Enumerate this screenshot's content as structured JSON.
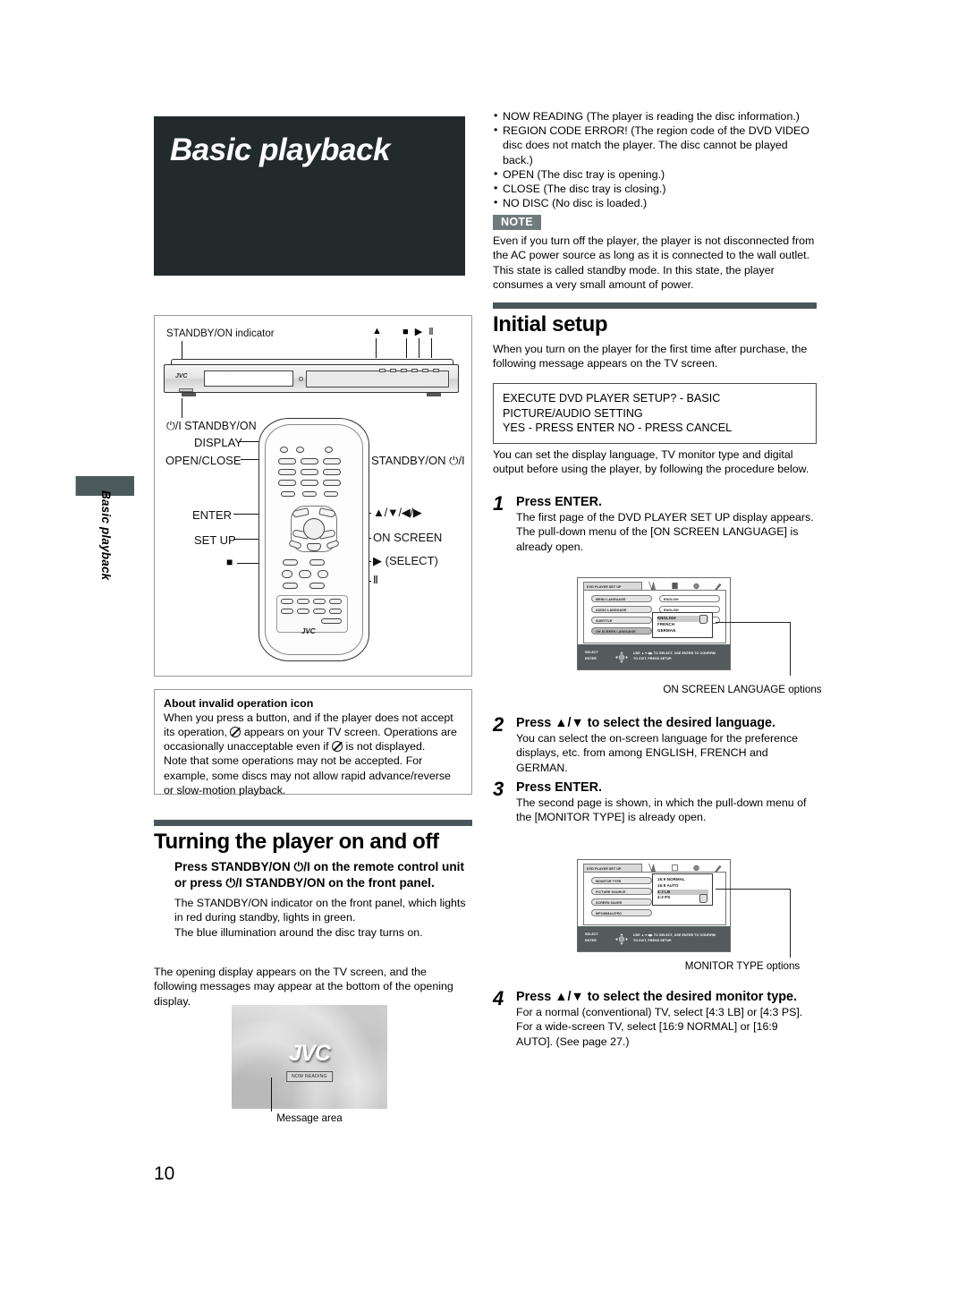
{
  "page": {
    "number": "10",
    "side_tab_label": "Basic playback",
    "title": "Basic playback"
  },
  "left": {
    "hw_figure": {
      "labels": {
        "standby_indicator": "STANDBY/ON indicator",
        "standby_front": "⏻/I STANDBY/ON",
        "display": "DISPLAY",
        "open_close": "OPEN/CLOSE",
        "enter": "ENTER",
        "set_up": "SET UP",
        "standby_remote": "STANDBY/ON ⏻/I",
        "arrows": "▲/▼/◀/▶",
        "on_screen": "ON SCREEN",
        "select": "▶ (SELECT)",
        "stop_icon": "■",
        "pause_icon": "Ⅱ",
        "eject_icon": "▲",
        "panel_icons": "■ ▶ Ⅱ",
        "remote_brand": "JVC",
        "panel_brand": "JVC"
      }
    },
    "invalid_box": {
      "heading": "About invalid operation icon",
      "body_1": "When you press a button, and if the player does not accept its operation,",
      "body_2": "appears on your TV screen. Operations are occasionally unacceptable even if",
      "body_3": "is not displayed.",
      "body_4": "Note that some operations may not be accepted. For example, some discs may not allow rapid advance/reverse or slow-motion playback."
    },
    "turning_section": {
      "heading": "Turning the player on and off",
      "bold_1": "Press STANDBY/ON",
      "bold_icon": "⏻/I",
      "bold_2": "on the remote control unit or press",
      "bold_3": "STANDBY/ON on the front panel.",
      "para_1": "The STANDBY/ON indicator on the front panel, which lights in red during standby, lights in green.",
      "para_2": "The blue illumination around the disc tray turns on.",
      "para_3": "The opening display appears on the TV screen, and the following messages may appear at the bottom of the opening display."
    },
    "opening_display": {
      "logo": "JVC",
      "message": "NOW READING",
      "caption": "Message area"
    }
  },
  "right": {
    "messages": [
      "NOW READING (The player is reading the disc information.)",
      "REGION CODE ERROR! (The region code of the DVD VIDEO disc does not match the player. The disc cannot be played back.)",
      "OPEN (The disc tray is opening.)",
      "CLOSE (The disc tray is closing.)",
      "NO DISC (No disc is loaded.)"
    ],
    "note": {
      "badge": "NOTE",
      "text": "Even if you turn off the player, the player is not disconnected from the AC power source as long as it is connected to the wall outlet. This state is called standby mode. In this state, the player consumes a very small amount of power."
    },
    "initial_setup": {
      "heading": "Initial setup",
      "intro": "When you turn on the player for the first time after purchase, the following message appears on the TV screen.",
      "message_box_line1": "EXECUTE DVD PLAYER SETUP? - BASIC PICTURE/AUDIO SETTING",
      "message_box_line2": "YES - PRESS ENTER    NO - PRESS CANCEL",
      "after_box": "You can set the display language, TV monitor type and digital output before using the player, by following the procedure below."
    },
    "steps": [
      {
        "num": "1",
        "title": "Press ENTER.",
        "body": "The first page of the DVD PLAYER SET UP display appears. The pull-down menu of the [ON SCREEN LANGUAGE] is already open."
      },
      {
        "num": "2",
        "title": "Press ▲/▼ to select the desired language.",
        "body": "You can select the on-screen language for the preference displays, etc. from among ENGLISH, FRENCH and GERMAN."
      },
      {
        "num": "3",
        "title": "Press ENTER.",
        "body": "The second page is shown, in which the pull-down menu of the [MONITOR TYPE] is already open."
      },
      {
        "num": "4",
        "title": "Press ▲/▼ to select the desired monitor type.",
        "body": "For a normal (conventional) TV, select [4:3 LB] or [4:3 PS]. For a wide-screen TV, select [16:9 NORMAL] or [16:9 AUTO]. (See page 27.)"
      }
    ],
    "osd_1": {
      "tab_name": "DVD PLAYER SET UP",
      "rows": [
        {
          "label": "MENU LANGUAGE",
          "value": "ENGLISH"
        },
        {
          "label": "AUDIO LANGUAGE",
          "value": "ENGLISH"
        },
        {
          "label": "SUBTITLE",
          "value": "ENGLISH"
        },
        {
          "label": "ON SCREEN LANGUAGE",
          "value": ""
        }
      ],
      "pulldown": [
        "ENGLISH",
        "FRENCH",
        "GERMAN"
      ],
      "selected_index": 0,
      "bottom_left_1": "SELECT",
      "bottom_left_2": "ENTER",
      "bottom_right_1": "USE ▲▼◀▶ TO SELECT, USE ENTER TO CONFIRM",
      "bottom_right_2": "TO EXIT, PRESS SETUP.",
      "caption": "ON SCREEN LANGUAGE options"
    },
    "osd_2": {
      "tab_name": "DVD PLAYER SET UP",
      "rows": [
        {
          "label": "MONITOR TYPE",
          "value": ""
        },
        {
          "label": "PICTURE SOURCE",
          "value": ""
        },
        {
          "label": "SCREEN SAVER",
          "value": ""
        },
        {
          "label": "MP3/WMA/JPEG",
          "value": ""
        }
      ],
      "pulldown": [
        "16:9 NORMAL",
        "16:9 AUTO",
        "4:3 LB",
        "4:3 PS"
      ],
      "selected_index": 2,
      "bottom_left_1": "SELECT",
      "bottom_left_2": "ENTER",
      "bottom_right_1": "USE ▲▼◀▶ TO SELECT, USE ENTER TO CONFIRM",
      "bottom_right_2": "TO EXIT, PRESS SETUP.",
      "caption": "MONITOR TYPE options"
    }
  },
  "colors": {
    "title_bg": "#222a2c",
    "rule": "#4a575a",
    "note_badge": "#6f7a7d",
    "osd_bar": "#555b5d"
  }
}
